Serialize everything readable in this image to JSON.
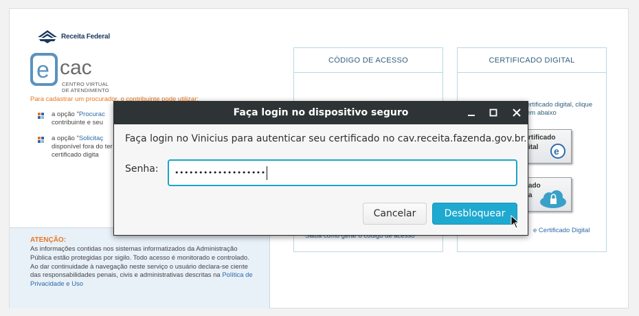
{
  "branding": {
    "brand_name": "Receita Federal",
    "logo_text": "cac",
    "logo_letter": "e",
    "subtitle_lines": [
      "CENTRO VIRTUAL",
      "DE ATENDIMENTO"
    ]
  },
  "left": {
    "procurador_text": "Para cadastrar um procurador, o contribuinte pode utilizar:",
    "options": [
      {
        "prefix": "a opção \"",
        "link": "Procurac",
        "rest": "contribuinte e seu "
      },
      {
        "prefix": "a opção \"",
        "link": "Solicitaç",
        "rest": "disponível fora do ter certificado digita"
      }
    ]
  },
  "atencao": {
    "title": "ATENÇÃO:",
    "body": "As informações contidas nos sistemas informatizados da Administração Pública estão protegidas por sigilo. Todo acesso é monitorado e controlado. Ao dar continuidade à navegação neste serviço o usuário declara-se ciente das responsabilidades penais, civis e administrativas descritas na ",
    "link": "Política de Privacidade e Uso"
  },
  "panels": {
    "codigo_title": "CÓDIGO DE ACESSO",
    "codigo_link": "Saiba como gerar o código de acesso",
    "cert_title": "CERTIFICADO DIGITAL",
    "cert_text_line1": "ertificado digital, clique",
    "cert_text_line2": "em abaixo",
    "cert_btn1_lines": [
      "rtificado",
      "ital"
    ],
    "cert_btn2_lines": [
      "ado",
      "a"
    ],
    "cert_link": "e Certificado Digital"
  },
  "dialog": {
    "title": "Faça login no dispositivo seguro",
    "prompt": "Faça login no Vinicius para autenticar seu certificado no cav.receita.fazenda.gov.br.",
    "password_label": "Senha:",
    "password_value": "•••••••••••••••••••",
    "cancel_label": "Cancelar",
    "unlock_label": "Desbloquear",
    "accent_color": "#1ea9d0",
    "titlebar_color": "#2e3436"
  }
}
